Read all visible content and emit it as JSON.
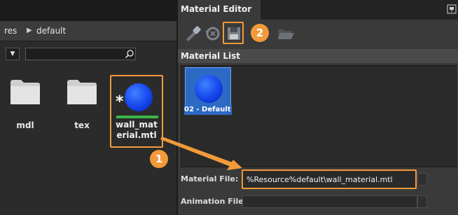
{
  "asset_browser": {
    "breadcrumb": {
      "root": "res",
      "separator": "▶",
      "folder": "default"
    },
    "filter": {
      "dropdown_icon": "chevron-down-icon",
      "search_value": "",
      "search_icon": "search-icon"
    },
    "assets": [
      {
        "name": "mdl",
        "icon": "folder-icon"
      },
      {
        "name": "tex",
        "icon": "folder-icon"
      },
      {
        "name": "wall_mat\nerial.mtl",
        "icon": "material-sphere-icon",
        "modified_marker": "*",
        "status_color": "#3cb54a"
      }
    ]
  },
  "material_editor": {
    "title": "Material Editor",
    "pin_icon": "pin-icon",
    "toolbar": [
      "eyedropper-icon",
      "reset-icon",
      "save-icon",
      "open-folder-icon"
    ],
    "material_list": {
      "header": "Material List",
      "items": [
        {
          "label": "02 - Default"
        }
      ]
    },
    "material_file": {
      "label": "Material File:",
      "value": "%Resource%default\\wall_material.mtl"
    },
    "animation_file": {
      "label": "Animation File:",
      "value": ""
    }
  },
  "annotations": {
    "step1": "1",
    "step2": "2",
    "color": "#f29a3a"
  },
  "colors": {
    "accent": "#f29a3a",
    "selection": "#2d6ac4",
    "sphere": "#1c4ff0",
    "status_bar": "#3cb54a"
  }
}
